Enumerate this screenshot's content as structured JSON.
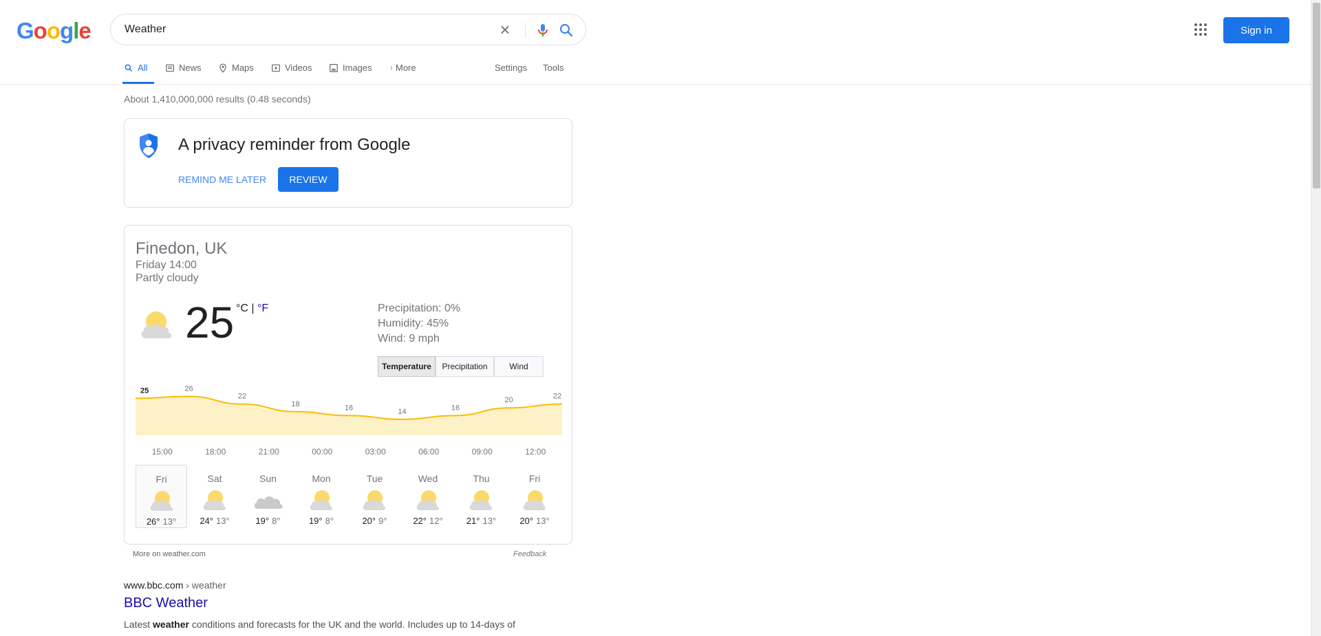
{
  "header": {
    "logo_letters": [
      {
        "ch": "G",
        "color": "#4285f4"
      },
      {
        "ch": "o",
        "color": "#ea4335"
      },
      {
        "ch": "o",
        "color": "#fbbc05"
      },
      {
        "ch": "g",
        "color": "#4285f4"
      },
      {
        "ch": "l",
        "color": "#34a853"
      },
      {
        "ch": "e",
        "color": "#ea4335"
      }
    ],
    "search_value": "Weather",
    "clear_icon": "close-icon",
    "mic_icon": "microphone-icon",
    "search_icon": "search-icon",
    "apps_icon": "apps-grid-icon",
    "sign_in_label": "Sign in"
  },
  "tabs": {
    "items": [
      {
        "label": "All",
        "icon": "search-icon",
        "active": true
      },
      {
        "label": "News",
        "icon": "news-icon",
        "active": false
      },
      {
        "label": "Maps",
        "icon": "map-pin-icon",
        "active": false
      },
      {
        "label": "Videos",
        "icon": "video-icon",
        "active": false
      },
      {
        "label": "Images",
        "icon": "image-icon",
        "active": false
      },
      {
        "label": "More",
        "icon": "more-vert-icon",
        "active": false
      }
    ],
    "settings_label": "Settings",
    "tools_label": "Tools"
  },
  "results_stats": "About 1,410,000,000 results (0.48 seconds)",
  "privacy": {
    "title": "A privacy reminder from Google",
    "remind_label": "REMIND ME LATER",
    "review_label": "REVIEW",
    "icon": "shield-icon"
  },
  "weather": {
    "location": "Finedon, UK",
    "time": "Friday 14:00",
    "condition": "Partly cloudy",
    "temperature": "25",
    "unit_c": "°C",
    "unit_sep": " | ",
    "unit_f": "°F",
    "precipitation": "Precipitation: 0%",
    "humidity": "Humidity: 45%",
    "wind": "Wind: 9 mph",
    "buttons": [
      "Temperature",
      "Precipitation",
      "Wind"
    ],
    "active_button": "Temperature",
    "more_link": "More on weather.com",
    "feedback": "Feedback",
    "colors": {
      "line": "#fbbc04",
      "fill": "#fdf1c7"
    },
    "days": [
      {
        "name": "Fri",
        "hi": "26°",
        "lo": "13°",
        "icon": "partly-cloudy-icon",
        "selected": true
      },
      {
        "name": "Sat",
        "hi": "24°",
        "lo": "13°",
        "icon": "partly-cloudy-icon",
        "selected": false
      },
      {
        "name": "Sun",
        "hi": "19°",
        "lo": "8°",
        "icon": "cloudy-icon",
        "selected": false
      },
      {
        "name": "Mon",
        "hi": "19°",
        "lo": "8°",
        "icon": "partly-cloudy-icon",
        "selected": false
      },
      {
        "name": "Tue",
        "hi": "20°",
        "lo": "9°",
        "icon": "partly-cloudy-icon",
        "selected": false
      },
      {
        "name": "Wed",
        "hi": "22°",
        "lo": "12°",
        "icon": "partly-cloudy-icon",
        "selected": false
      },
      {
        "name": "Thu",
        "hi": "21°",
        "lo": "13°",
        "icon": "partly-cloudy-icon",
        "selected": false
      },
      {
        "name": "Fri",
        "hi": "20°",
        "lo": "13°",
        "icon": "partly-cloudy-icon",
        "selected": false
      }
    ]
  },
  "chart_data": {
    "type": "area",
    "x": [
      "15:00",
      "18:00",
      "21:00",
      "00:00",
      "03:00",
      "06:00",
      "09:00",
      "12:00"
    ],
    "values": [
      25,
      26,
      22,
      18,
      16,
      14,
      16,
      20,
      22
    ],
    "value_labels": [
      "25",
      "26",
      "22",
      "18",
      "16",
      "14",
      "16",
      "20",
      "22"
    ],
    "series": [
      {
        "name": "",
        "values": [
          25,
          26,
          22,
          18,
          16,
          14,
          16,
          20,
          22
        ]
      }
    ],
    "title": "",
    "xlabel": "",
    "ylabel": "",
    "ylim": [
      10,
      28
    ]
  },
  "result": {
    "domain": "www.bbc.com",
    "crumb": " › weather",
    "title": "BBC Weather",
    "snippet_pre": "Latest ",
    "snippet_bold": "weather",
    "snippet_post": " conditions and forecasts for the UK and the world. Includes up to 14-days of"
  }
}
